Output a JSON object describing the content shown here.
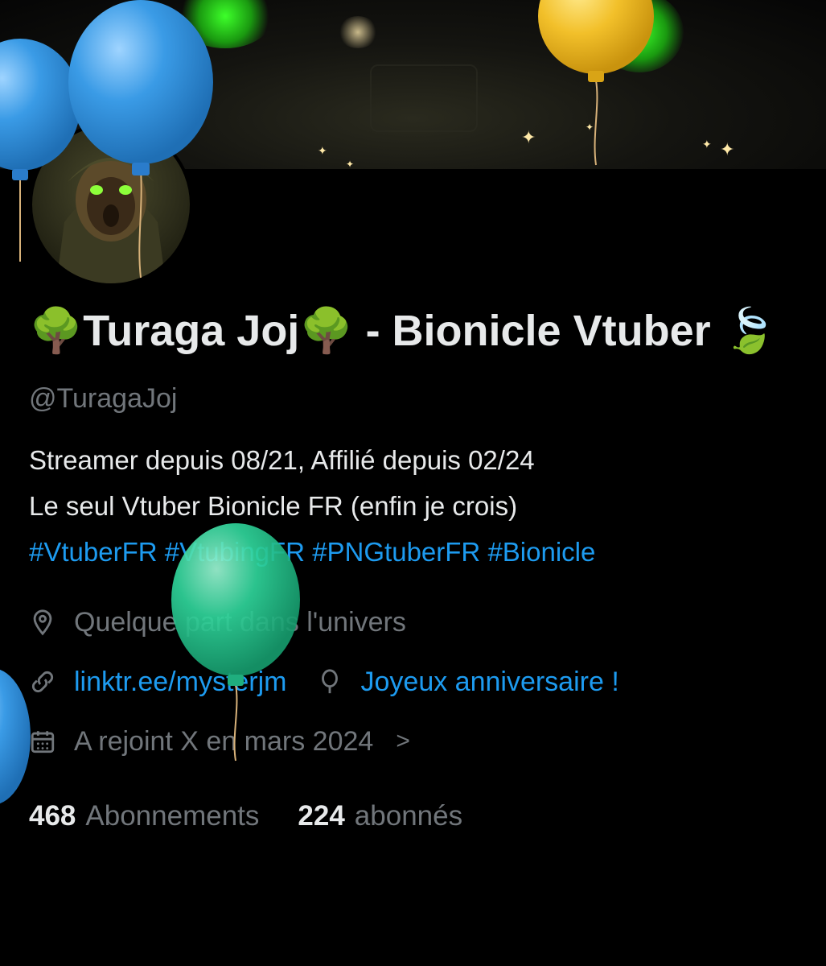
{
  "profile": {
    "name_emoji": "🌳",
    "name_main": "Turaga Joj",
    "name_rest": " - Bionicle Vtuber ",
    "name_trail_emoji": "🍃",
    "handle": "@TuragaJoj",
    "bio_line1": "Streamer depuis 08/21, Affilié depuis  02/24",
    "bio_line2": "Le seul Vtuber Bionicle FR (enfin je crois)",
    "hashtags": [
      "#VtuberFR",
      "#VtubingFR",
      "#PNGtuberFR",
      "#Bionicle"
    ]
  },
  "meta": {
    "location": "Quelque part dans l'univers",
    "website": "linktr.ee/mysterjm",
    "birthday": "Joyeux anniversaire !",
    "joined": "A rejoint X en mars 2024",
    "icons": [
      "location-icon",
      "link-icon",
      "balloon-icon",
      "calendar-icon",
      "chevron-right-icon"
    ]
  },
  "stats": {
    "following_count": "468",
    "following_label": "Abonnements",
    "followers_count": "224",
    "followers_label": "abonnés"
  },
  "colors": {
    "background": "#000000",
    "text": "#e7e9ea",
    "muted": "#71767b",
    "link": "#1d9bf0",
    "balloon_blue": "#3a9be6",
    "balloon_yellow": "#f2c02a",
    "balloon_teal": "#2fd49a"
  }
}
